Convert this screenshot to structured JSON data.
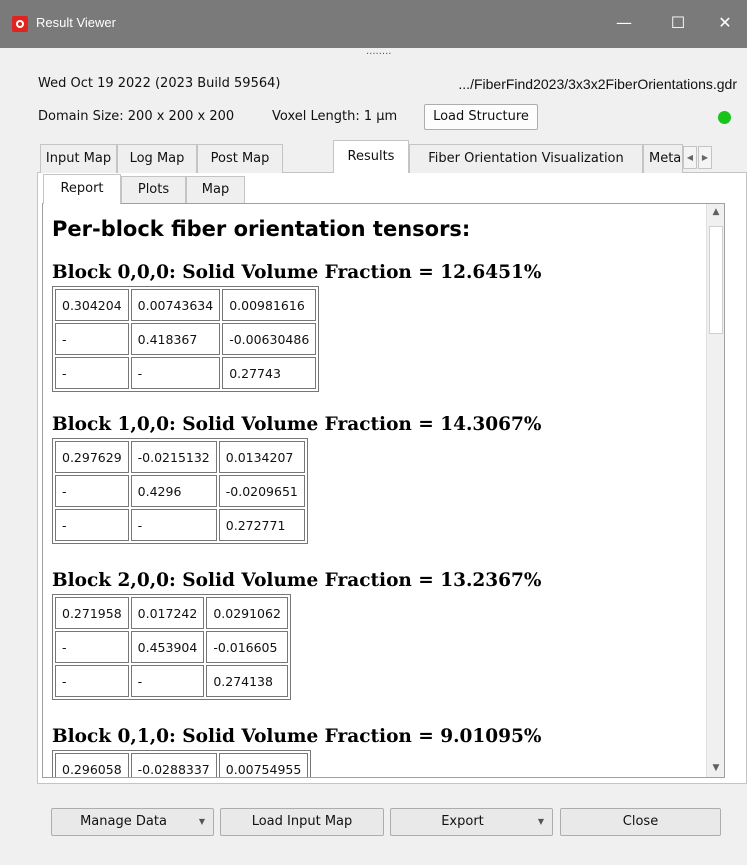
{
  "window": {
    "title": "Result Viewer",
    "minimize_glyph": "—",
    "maximize_glyph": "☐",
    "close_glyph": "✕",
    "app_icon": "red-target-icon"
  },
  "splitter": {
    "handle_glyph": "········"
  },
  "info": {
    "date_build": "Wed Oct 19 2022 (2023 Build 59564)",
    "path": ".../FiberFind2023/3x3x2FiberOrientations.gdr",
    "domain_size": "Domain Size: 200 x 200 x 200",
    "voxel_length": "Voxel Length: 1 µm",
    "load_structure_label": "Load Structure",
    "status_color": "#17c417"
  },
  "tabs": [
    "Input Map",
    "Log Map",
    "Post Map",
    "Results",
    "Fiber Orientation Visualization",
    "Meta"
  ],
  "active_tab": "Results",
  "tab_scroll": {
    "left_glyph": "◀",
    "right_glyph": "▶"
  },
  "subtabs": [
    "Report",
    "Plots",
    "Map"
  ],
  "active_subtab": "Report",
  "report": {
    "heading": "Per-block fiber orientation tensors:",
    "blocks": [
      {
        "title": "Block 0,0,0: Solid Volume Fraction = 12.6451%",
        "rows": [
          [
            "0.304204",
            "0.00743634",
            "0.00981616"
          ],
          [
            "-",
            "0.418367",
            "-0.00630486"
          ],
          [
            "-",
            "-",
            "0.27743"
          ]
        ]
      },
      {
        "title": "Block 1,0,0: Solid Volume Fraction = 14.3067%",
        "rows": [
          [
            "0.297629",
            "-0.0215132",
            "0.0134207"
          ],
          [
            "-",
            "0.4296",
            "-0.0209651"
          ],
          [
            "-",
            "-",
            "0.272771"
          ]
        ]
      },
      {
        "title": "Block 2,0,0: Solid Volume Fraction = 13.2367%",
        "rows": [
          [
            "0.271958",
            "0.017242",
            "0.0291062"
          ],
          [
            "-",
            "0.453904",
            "-0.016605"
          ],
          [
            "-",
            "-",
            "0.274138"
          ]
        ]
      },
      {
        "title": "Block 0,1,0: Solid Volume Fraction = 9.01095%",
        "rows": [
          [
            "0.296058",
            "-0.0288337",
            "0.00754955"
          ]
        ]
      }
    ]
  },
  "scrollbar": {
    "up_glyph": "▲",
    "down_glyph": "▼"
  },
  "buttons": {
    "manage_data": "Manage Data",
    "load_input_map": "Load Input Map",
    "export": "Export",
    "close": "Close",
    "dropdown_glyph": "▼"
  }
}
